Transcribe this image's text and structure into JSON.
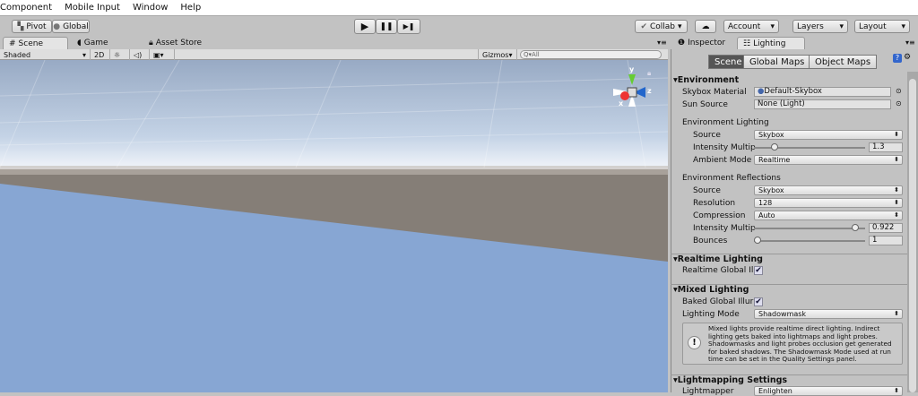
{
  "menu": [
    "Component",
    "Mobile Input",
    "Window",
    "Help"
  ],
  "toolbar": {
    "pivot": "Pivot",
    "global": "Global",
    "play": "▶",
    "pause": "❚❚",
    "step": "▶❚",
    "collab": "Collab",
    "account": "Account",
    "layers": "Layers",
    "layout": "Layout"
  },
  "tabs": {
    "scene": "Scene",
    "game": "Game",
    "asset_store": "Asset Store",
    "inspector": "Inspector",
    "lighting": "Lighting"
  },
  "scene_bar": {
    "shading": "Shaded",
    "mode2d": "2D",
    "gizmos": "Gizmos",
    "search_placeholder": "All"
  },
  "gizmo": {
    "y": "y",
    "z": "z",
    "x": "x"
  },
  "lighting": {
    "segments": [
      "Scene",
      "Global Maps",
      "Object Maps"
    ],
    "environment": {
      "title": "Environment",
      "skybox_label": "Skybox Material",
      "skybox_value": "Default-Skybox",
      "sun_label": "Sun Source",
      "sun_value": "None (Light)",
      "env_lighting": "Environment Lighting",
      "source_label": "Source",
      "source_value": "Skybox",
      "intensity_label": "Intensity Multip",
      "intensity_value": "1.3",
      "intensity_fraction": 0.15,
      "ambient_label": "Ambient Mode",
      "ambient_value": "Realtime",
      "env_reflections": "Environment Reflections",
      "rsource_label": "Source",
      "rsource_value": "Skybox",
      "resolution_label": "Resolution",
      "resolution_value": "128",
      "compression_label": "Compression",
      "compression_value": "Auto",
      "rintensity_label": "Intensity Multip",
      "rintensity_value": "0.922",
      "rintensity_fraction": 0.92,
      "bounces_label": "Bounces",
      "bounces_value": "1",
      "bounces_fraction": 0.0
    },
    "realtime": {
      "title": "Realtime Lighting",
      "gi_label": "Realtime Global Il",
      "gi_checked": true
    },
    "mixed": {
      "title": "Mixed Lighting",
      "baked_label": "Baked Global Illur",
      "baked_checked": true,
      "mode_label": "Lighting Mode",
      "mode_value": "Shadowmask",
      "info": "Mixed lights provide realtime direct lighting. Indirect lighting gets baked into lightmaps and light probes. Shadowmasks and light probes occlusion get generated for baked shadows. The Shadowmask Mode used at run time can be set in the Quality Settings panel."
    },
    "lightmapping": {
      "title": "Lightmapping Settings",
      "lightmapper_label": "Lightmapper",
      "lightmapper_value": "Enlighten"
    }
  }
}
